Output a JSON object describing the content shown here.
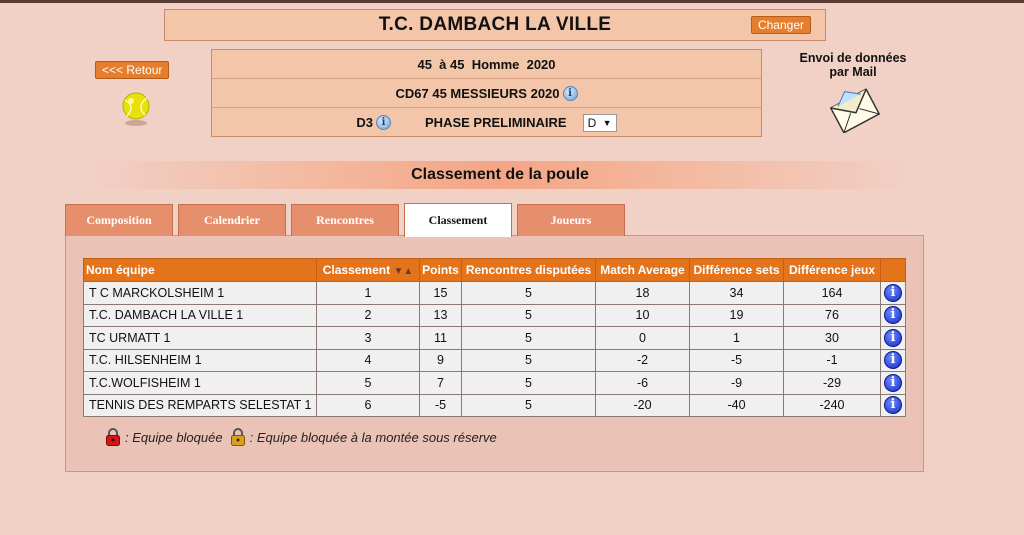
{
  "header": {
    "club_name": "T.C. DAMBACH LA VILLE",
    "change_label": "Changer"
  },
  "nav": {
    "back_label": "<<< Retour"
  },
  "competition": {
    "line1": "45  à 45  Homme  2020",
    "line2": "CD67 45 MESSIEURS 2020",
    "division": "D3",
    "phase": "PHASE PRELIMINAIRE",
    "poule_select_value": "D",
    "select_arrow": "▼"
  },
  "mail": {
    "line1": "Envoi de données",
    "line2": "par Mail"
  },
  "section_title": "Classement de la poule",
  "tabs": [
    {
      "label": "Composition"
    },
    {
      "label": "Calendrier"
    },
    {
      "label": "Rencontres"
    },
    {
      "label": "Classement"
    },
    {
      "label": "Joueurs"
    }
  ],
  "table": {
    "headers": {
      "team": "Nom équipe",
      "rank": "Classement",
      "sort_arrows": "▼▲",
      "points": "Points",
      "played": "Rencontres disputées",
      "match_avg": "Match Average",
      "sets_diff": "Différence sets",
      "games_diff": "Différence jeux"
    },
    "rows": [
      {
        "team": "T C MARCKOLSHEIM 1",
        "rank": "1",
        "points": "15",
        "played": "5",
        "match_avg": "18",
        "sets_diff": "34",
        "games_diff": "164"
      },
      {
        "team": "T.C. DAMBACH LA VILLE 1",
        "rank": "2",
        "points": "13",
        "played": "5",
        "match_avg": "10",
        "sets_diff": "19",
        "games_diff": "76"
      },
      {
        "team": "TC URMATT 1",
        "rank": "3",
        "points": "11",
        "played": "5",
        "match_avg": "0",
        "sets_diff": "1",
        "games_diff": "30"
      },
      {
        "team": "T.C. HILSENHEIM 1",
        "rank": "4",
        "points": "9",
        "played": "5",
        "match_avg": "-2",
        "sets_diff": "-5",
        "games_diff": "-1"
      },
      {
        "team": "T.C.WOLFISHEIM 1",
        "rank": "5",
        "points": "7",
        "played": "5",
        "match_avg": "-6",
        "sets_diff": "-9",
        "games_diff": "-29"
      },
      {
        "team": "TENNIS DES REMPARTS SELESTAT 1",
        "rank": "6",
        "points": "-5",
        "played": "5",
        "match_avg": "-20",
        "sets_diff": "-40",
        "games_diff": "-240"
      }
    ]
  },
  "legend": {
    "blocked": ": Equipe bloquée",
    "blocked_reserve": ": Equipe bloquée à la montée sous réserve"
  },
  "colors": {
    "header_orange": "#e4741c",
    "tab_salmon": "#e58f6d",
    "info_blue": "#1327c9"
  }
}
